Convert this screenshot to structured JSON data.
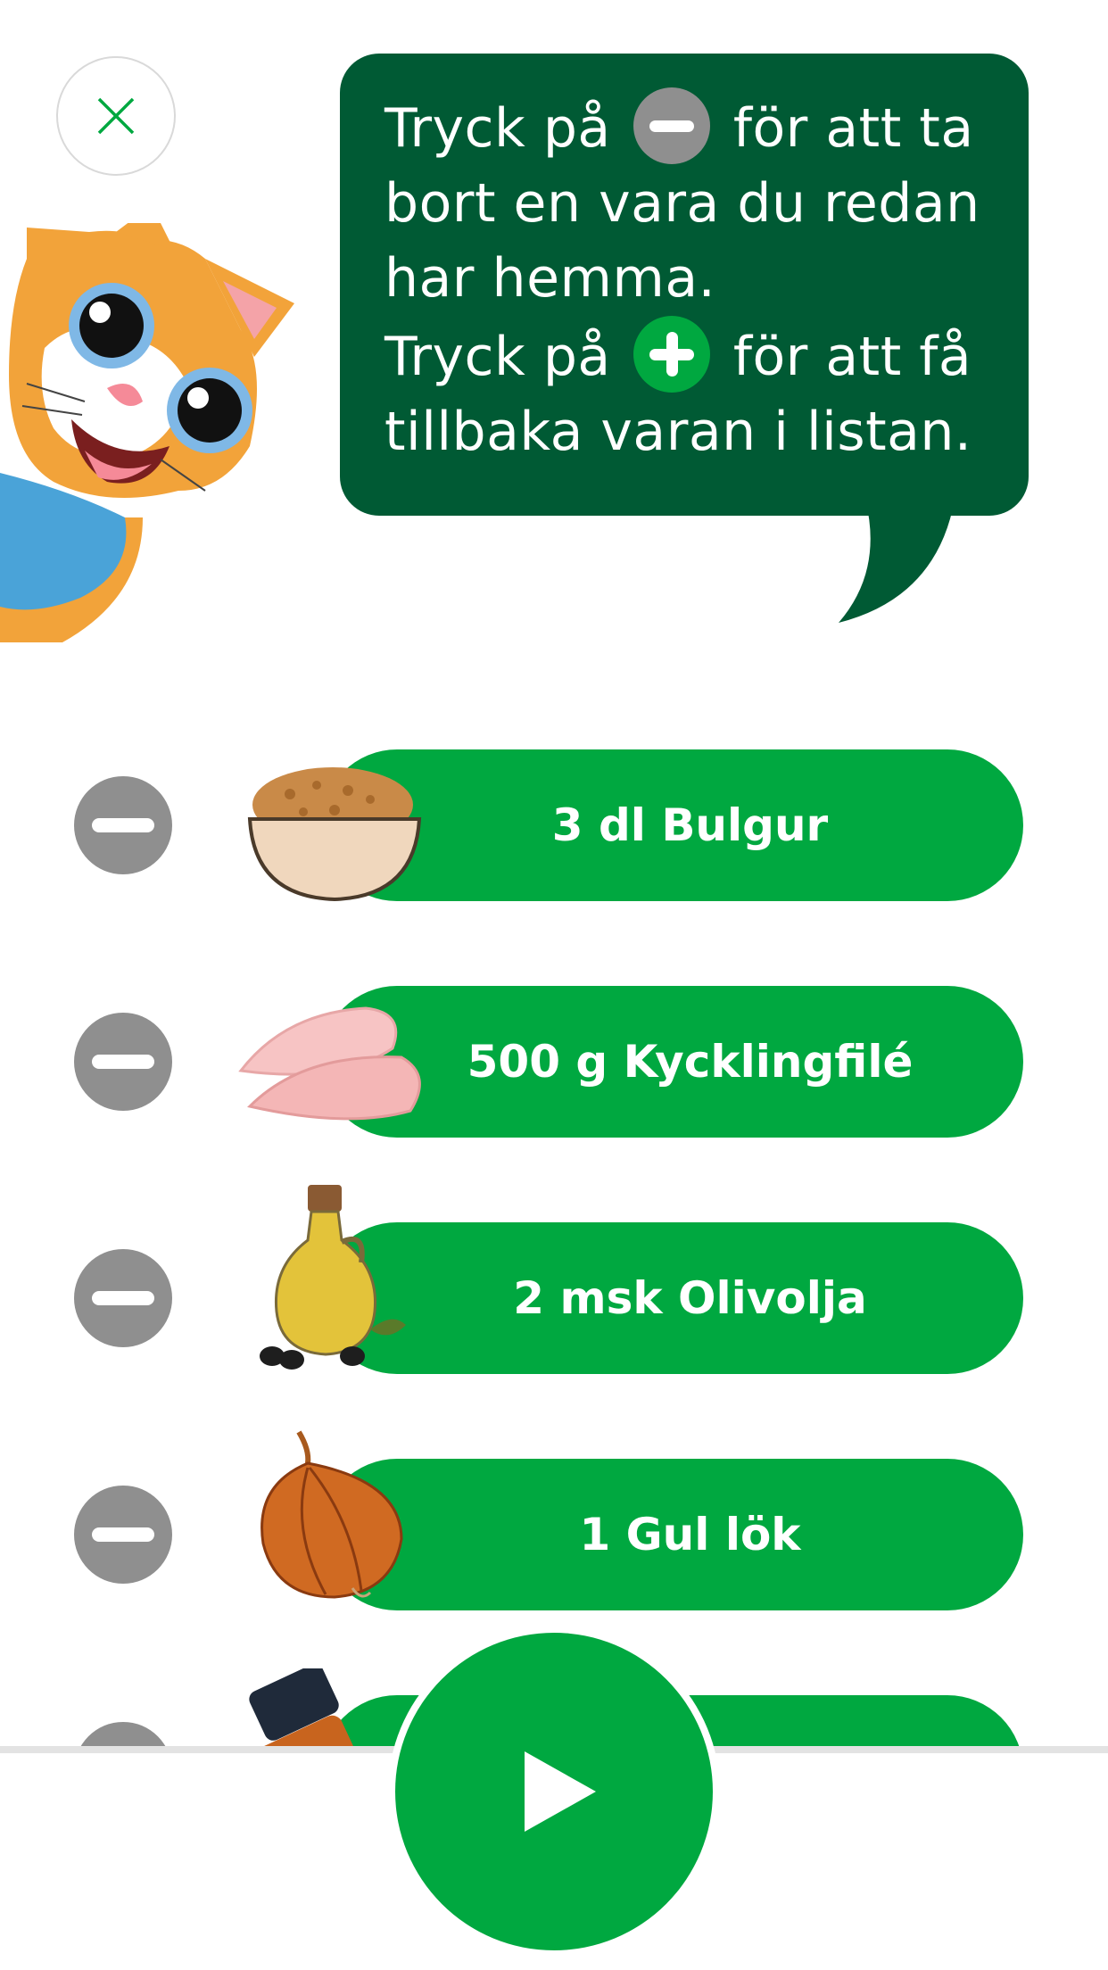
{
  "bubble": {
    "line1_before": "Tryck på",
    "line1_after": "för att ta",
    "line2": "bort en vara du redan",
    "line3": "har hemma.",
    "line4_before": "Tryck på",
    "line4_after": "för att få",
    "line5": "tillbaka varan i listan."
  },
  "icons": {
    "close": "close-icon",
    "remove": "minus-icon",
    "add": "plus-icon",
    "play": "play-icon"
  },
  "colors": {
    "bubble": "#005a34",
    "accent": "#00a840",
    "remove_button": "#8f8f8f"
  },
  "ingredients": [
    {
      "label": "3 dl Bulgur",
      "image": "bulgur-bowl"
    },
    {
      "label": "500 g Kycklingfilé",
      "image": "chicken-fillet"
    },
    {
      "label": "2 msk Olivolja",
      "image": "olive-oil-bottle"
    },
    {
      "label": "1  Gul lök",
      "image": "yellow-onion"
    },
    {
      "label": "",
      "image": "spice-jar"
    }
  ]
}
